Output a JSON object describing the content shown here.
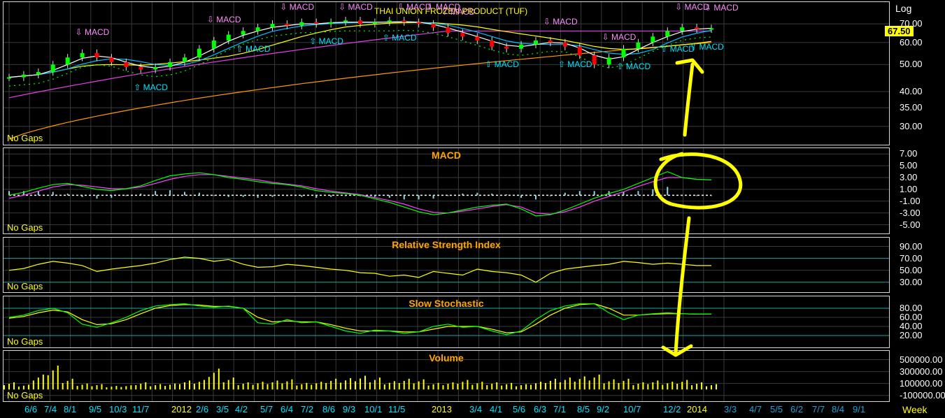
{
  "main": {
    "title": "THAI UNION FROZEN PRODUCT (TUF)",
    "scale": "Log",
    "last_price": "67.50",
    "no_gaps": "No Gaps",
    "yticks": [
      "70.00",
      "60.00",
      "50.00",
      "40.00",
      "35.00",
      "30.00"
    ],
    "signal_label": "MACD",
    "sell_signals": 11,
    "buy_signals": 9
  },
  "macd_panel": {
    "title": "MACD",
    "no_gaps": "No Gaps",
    "yticks": [
      "7.00",
      "5.00",
      "3.00",
      "1.00",
      "-1.00",
      "-3.00",
      "-5.00"
    ]
  },
  "rsi_panel": {
    "title": "Relative Strength Index",
    "no_gaps": "No Gaps",
    "yticks": [
      "90.00",
      "70.00",
      "50.00",
      "30.00"
    ]
  },
  "stoch_panel": {
    "title": "Slow Stochastic",
    "no_gaps": "No Gaps",
    "yticks": [
      "80.00",
      "60.00",
      "40.00",
      "20.00"
    ]
  },
  "volume_panel": {
    "title": "Volume",
    "no_gaps": "No Gaps",
    "yticks": [
      "500000.00",
      "300000.00",
      "100000.00",
      "-100000.00"
    ]
  },
  "xaxis": {
    "labels": [
      "6/6",
      "7/4",
      "8/1",
      "9/5",
      "10/3",
      "11/7",
      "2012",
      "2/6",
      "3/5",
      "4/2",
      "5/7",
      "6/4",
      "7/2",
      "8/6",
      "9/3",
      "10/1",
      "11/5",
      "2013",
      "3/4",
      "4/1",
      "5/6",
      "6/3",
      "7/1",
      "8/5",
      "9/2",
      "10/7",
      "12/2",
      "2014",
      "3/3",
      "4/7",
      "5/5",
      "6/2",
      "7/7",
      "8/4",
      "9/1"
    ],
    "period": "Week"
  },
  "colors": {
    "up": "#00ff00",
    "down": "#ff0000",
    "ma_short": "#ffffff",
    "ma_mid": "#00bfff",
    "ma_long": "#ffff00",
    "ma_200": "#e040e0",
    "ma_400": "#ff9900",
    "macd": "#00ff00",
    "signal": "#ff40ff",
    "annotation": "#ffff00"
  },
  "chart_data": [
    {
      "type": "line",
      "title": "THAI UNION FROZEN PRODUCT (TUF)",
      "series": [
        {
          "name": "close",
          "values": [
            45,
            46,
            47,
            50,
            53,
            55,
            53,
            51,
            49,
            48,
            49,
            51,
            53,
            57,
            61,
            64,
            66,
            68,
            70,
            69,
            71,
            70,
            71,
            72,
            70,
            71,
            72,
            71,
            70,
            68,
            65,
            63,
            61,
            58,
            57,
            59,
            61,
            60,
            58,
            54,
            50,
            53,
            57,
            60,
            63,
            66,
            68,
            67,
            67.5
          ]
        }
      ],
      "ylim": [
        27,
        80
      ]
    },
    {
      "type": "line",
      "title": "MACD",
      "series": [
        {
          "name": "macd",
          "values": [
            0,
            0.5,
            1.2,
            1.8,
            2.0,
            1.5,
            1.0,
            0.8,
            1.1,
            1.6,
            2.5,
            3.3,
            3.6,
            3.8,
            3.5,
            3.0,
            2.7,
            2.3,
            2.0,
            1.8,
            1.4,
            0.8,
            0.5,
            0.3,
            0.0,
            -0.6,
            -1.2,
            -2.0,
            -2.8,
            -3.3,
            -3.0,
            -2.5,
            -2.0,
            -1.7,
            -1.5,
            -2.3,
            -3.5,
            -3.3,
            -2.5,
            -1.5,
            -0.5,
            0.3,
            1.0,
            2.0,
            3.0,
            4.0,
            3.0,
            2.7,
            2.6
          ]
        },
        {
          "name": "signal",
          "values": [
            -0.5,
            0,
            0.7,
            1.4,
            1.8,
            1.7,
            1.4,
            1.1,
            1.1,
            1.4,
            2.0,
            2.7,
            3.2,
            3.5,
            3.5,
            3.2,
            2.9,
            2.6,
            2.2,
            1.9,
            1.6,
            1.1,
            0.7,
            0.4,
            0.1,
            -0.4,
            -0.9,
            -1.5,
            -2.3,
            -2.9,
            -3.0,
            -2.7,
            -2.3,
            -1.9,
            -1.6,
            -2.0,
            -3.0,
            -3.2,
            -2.8,
            -2.0,
            -1.0,
            -0.2,
            0.6,
            1.5,
            2.3,
            3.0,
            3.0,
            2.7,
            2.6
          ]
        }
      ],
      "ylim": [
        -6,
        7.5
      ]
    },
    {
      "type": "line",
      "title": "Relative Strength Index",
      "series": [
        {
          "name": "RSI",
          "values": [
            50,
            53,
            60,
            65,
            62,
            58,
            48,
            52,
            55,
            58,
            62,
            68,
            72,
            70,
            65,
            68,
            60,
            55,
            56,
            60,
            58,
            55,
            52,
            50,
            46,
            45,
            40,
            42,
            38,
            48,
            45,
            42,
            52,
            48,
            46,
            42,
            30,
            45,
            52,
            55,
            58,
            60,
            65,
            63,
            60,
            62,
            60,
            58,
            58
          ]
        }
      ],
      "ylim": [
        18,
        100
      ]
    },
    {
      "type": "line",
      "title": "Slow Stochastic",
      "series": [
        {
          "name": "%K",
          "values": [
            60,
            65,
            75,
            80,
            70,
            45,
            38,
            48,
            60,
            75,
            85,
            88,
            90,
            85,
            82,
            85,
            80,
            48,
            45,
            55,
            48,
            50,
            40,
            30,
            25,
            32,
            30,
            25,
            28,
            40,
            45,
            38,
            40,
            30,
            22,
            30,
            55,
            75,
            85,
            90,
            90,
            70,
            55,
            65,
            68,
            70,
            68,
            67,
            67
          ]
        },
        {
          "name": "%D",
          "values": [
            58,
            62,
            70,
            76,
            72,
            55,
            44,
            46,
            55,
            68,
            80,
            86,
            88,
            87,
            84,
            84,
            80,
            60,
            50,
            52,
            50,
            50,
            44,
            36,
            30,
            30,
            30,
            28,
            28,
            34,
            40,
            40,
            40,
            34,
            26,
            28,
            45,
            65,
            80,
            88,
            90,
            80,
            65,
            65,
            67,
            68,
            68,
            67,
            67
          ]
        }
      ],
      "ylim": [
        0,
        100
      ]
    },
    {
      "type": "bar",
      "title": "Volume",
      "values": [
        120000,
        80000,
        250000,
        400000,
        180000,
        100000,
        90000,
        60000,
        70000,
        120000,
        90000,
        100000,
        150000,
        160000,
        350000,
        200000,
        120000,
        130000,
        150000,
        170000,
        110000,
        130000,
        180000,
        190000,
        230000,
        200000,
        140000,
        180000,
        170000,
        110000,
        120000,
        160000,
        130000,
        120000,
        110000,
        90000,
        130000,
        180000,
        200000,
        220000,
        250000,
        170000,
        180000,
        120000,
        150000,
        130000,
        160000,
        120000,
        90000
      ],
      "ylim": [
        -150000,
        600000
      ]
    }
  ]
}
